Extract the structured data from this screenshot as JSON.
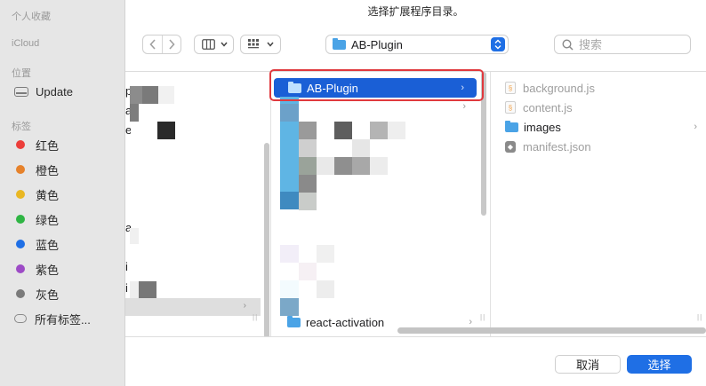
{
  "dialog": {
    "title": "选择扩展程序目录。"
  },
  "sidebar": {
    "sections": {
      "favorites": "个人收藏",
      "icloud": "iCloud",
      "locations": "位置",
      "tags": "标签"
    },
    "locations": [
      {
        "label": "Update",
        "icon": "disk-icon"
      }
    ],
    "tags": [
      {
        "label": "红色",
        "color": "#ec3e3a"
      },
      {
        "label": "橙色",
        "color": "#e6822b"
      },
      {
        "label": "黄色",
        "color": "#e9b723"
      },
      {
        "label": "绿色",
        "color": "#2fb544"
      },
      {
        "label": "蓝色",
        "color": "#1f6fe5"
      },
      {
        "label": "紫色",
        "color": "#9d4bc6"
      },
      {
        "label": "灰色",
        "color": "#7a7a7a"
      }
    ],
    "all_tags": "所有标签..."
  },
  "toolbar": {
    "back_icon": "chevron-left-icon",
    "forward_icon": "chevron-right-icon",
    "location": "AB-Plugin",
    "search_placeholder": "搜索"
  },
  "browser": {
    "col1_glyphs": {
      "a": "p",
      "b": "a",
      "c": "e",
      "d": "a",
      "e": "i",
      "f": "i"
    },
    "col2": {
      "selected": "AB-Plugin",
      "bottom_item": "react-activation"
    },
    "col3": {
      "items": [
        {
          "label": "background.js",
          "type": "js"
        },
        {
          "label": "content.js",
          "type": "js"
        },
        {
          "label": "images",
          "type": "folder"
        },
        {
          "label": "manifest.json",
          "type": "json"
        }
      ]
    }
  },
  "buttons": {
    "cancel": "取消",
    "choose": "选择"
  },
  "colors": {
    "accent": "#1f6fe5",
    "selection": "#1a5fd6",
    "highlight_box": "#e0393e"
  }
}
